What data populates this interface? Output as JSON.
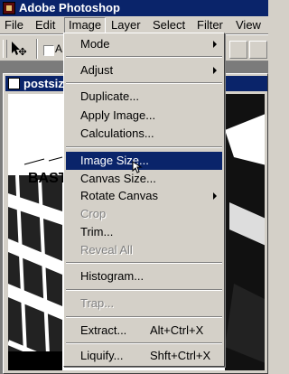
{
  "window": {
    "title": "Adobe Photoshop"
  },
  "menubar": [
    {
      "label": "File"
    },
    {
      "label": "Edit"
    },
    {
      "label": "Image"
    },
    {
      "label": "Layer"
    },
    {
      "label": "Select"
    },
    {
      "label": "Filter"
    },
    {
      "label": "View"
    }
  ],
  "options_bar": {
    "checkbox_label": "A"
  },
  "document": {
    "title": "postsiz",
    "art_text": "BAST"
  },
  "image_menu": {
    "items": [
      {
        "label": "Mode"
      },
      {
        "label": "Adjust"
      },
      {
        "label": "Duplicate..."
      },
      {
        "label": "Apply Image..."
      },
      {
        "label": "Calculations..."
      },
      {
        "label": "Image Size..."
      },
      {
        "label": "Canvas Size..."
      },
      {
        "label": "Rotate Canvas"
      },
      {
        "label": "Crop"
      },
      {
        "label": "Trim..."
      },
      {
        "label": "Reveal All"
      },
      {
        "label": "Histogram..."
      },
      {
        "label": "Trap..."
      },
      {
        "label": "Extract...",
        "shortcut": "Alt+Ctrl+X"
      },
      {
        "label": "Liquify...",
        "shortcut": "Shft+Ctrl+X"
      }
    ]
  },
  "colors": {
    "menu_highlight": "#0a246a",
    "title_bar": "#0a246a"
  }
}
